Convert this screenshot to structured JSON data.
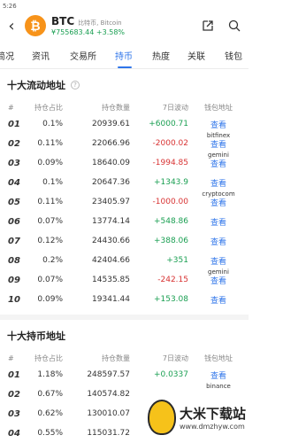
{
  "status": {
    "time": "5:26"
  },
  "header": {
    "symbol": "BTC",
    "subtitle": "比特币, Bitcoin",
    "price_line": "¥755683.44 +3.58%",
    "colors": {
      "logo": "#f7931a",
      "up": "#1a9f52",
      "down": "#d83333",
      "accent": "#2f75ea"
    }
  },
  "tabs": [
    {
      "label": "简况"
    },
    {
      "label": "资讯"
    },
    {
      "label": "交易所"
    },
    {
      "label": "持币"
    },
    {
      "label": "热度"
    },
    {
      "label": "关联"
    },
    {
      "label": "钱包"
    }
  ],
  "active_tab": "持币",
  "section1": {
    "title": "十大流动地址",
    "headers": {
      "rank": "#",
      "pct": "持仓占比",
      "qty": "持仓数量",
      "change": "7日波动",
      "wallet": "钱包地址"
    },
    "rows": [
      {
        "rank": "01",
        "pct": "0.1%",
        "qty": "20939.61",
        "change": "+6000.71",
        "dir": "up",
        "view": "查看",
        "wallet": "bitfinex"
      },
      {
        "rank": "02",
        "pct": "0.11%",
        "qty": "22066.96",
        "change": "-2000.02",
        "dir": "down",
        "view": "查看",
        "wallet": "gemini"
      },
      {
        "rank": "03",
        "pct": "0.09%",
        "qty": "18640.09",
        "change": "-1994.85",
        "dir": "down",
        "view": "查看",
        "wallet": ""
      },
      {
        "rank": "04",
        "pct": "0.1%",
        "qty": "20647.36",
        "change": "+1343.9",
        "dir": "up",
        "view": "查看",
        "wallet": "cryptocom"
      },
      {
        "rank": "05",
        "pct": "0.11%",
        "qty": "23405.97",
        "change": "-1000.00",
        "dir": "down",
        "view": "查看",
        "wallet": ""
      },
      {
        "rank": "06",
        "pct": "0.07%",
        "qty": "13774.14",
        "change": "+548.86",
        "dir": "up",
        "view": "查看",
        "wallet": ""
      },
      {
        "rank": "07",
        "pct": "0.12%",
        "qty": "24430.66",
        "change": "+388.06",
        "dir": "up",
        "view": "查看",
        "wallet": ""
      },
      {
        "rank": "08",
        "pct": "0.2%",
        "qty": "42404.66",
        "change": "+351",
        "dir": "up",
        "view": "查看",
        "wallet": "gemini"
      },
      {
        "rank": "09",
        "pct": "0.07%",
        "qty": "14535.85",
        "change": "-242.15",
        "dir": "down",
        "view": "查看",
        "wallet": ""
      },
      {
        "rank": "10",
        "pct": "0.09%",
        "qty": "19341.44",
        "change": "+153.08",
        "dir": "up",
        "view": "查看",
        "wallet": ""
      }
    ]
  },
  "section2": {
    "title": "十大持币地址",
    "headers": {
      "rank": "#",
      "pct": "持仓占比",
      "qty": "持仓数量",
      "change": "7日波动",
      "wallet": "钱包地址"
    },
    "rows": [
      {
        "rank": "01",
        "pct": "1.18%",
        "qty": "248597.57",
        "change": "+0.0337",
        "dir": "up",
        "view": "查看",
        "wallet": "binance"
      },
      {
        "rank": "02",
        "pct": "0.67%",
        "qty": "140574.82",
        "change": "",
        "dir": "up",
        "view": "",
        "wallet": ""
      },
      {
        "rank": "03",
        "pct": "0.62%",
        "qty": "130010.07",
        "change": "",
        "dir": "up",
        "view": "",
        "wallet": ""
      },
      {
        "rank": "04",
        "pct": "0.55%",
        "qty": "115031.72",
        "change": "",
        "dir": "up",
        "view": "",
        "wallet": ""
      }
    ]
  },
  "watermark": {
    "title": "大米下载站",
    "url": "www.dmzhyw.com"
  }
}
